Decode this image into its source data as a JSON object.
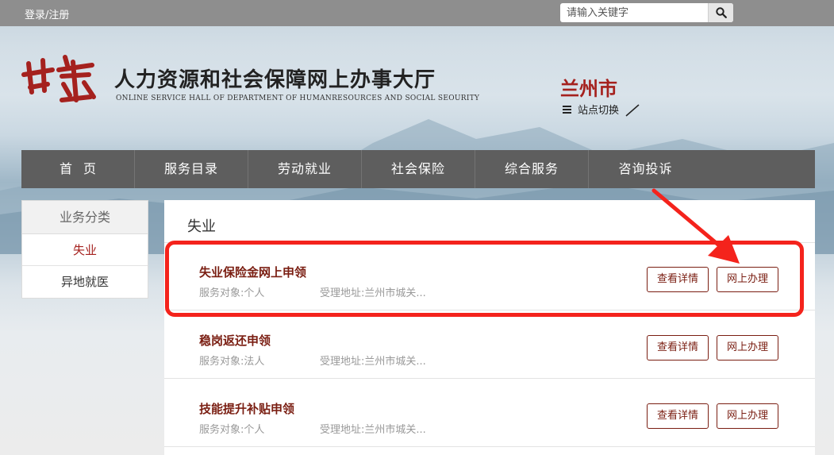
{
  "topbar": {
    "login_label": "登录/注册",
    "search_placeholder": "请输入关键字"
  },
  "header": {
    "logo_text": "甘肃",
    "title": "人力资源和社会保障网上办事大厅",
    "subtitle": "ONLINE SERVICE HALL OF DEPARTMENT OF HUMANRESOURCES AND SOCIAL SEOURITY",
    "city": "兰州市",
    "switch_label": "站点切换"
  },
  "nav": {
    "items": [
      "首页",
      "服务目录",
      "劳动就业",
      "社会保险",
      "综合服务",
      "咨询投诉"
    ]
  },
  "sidebar": {
    "heading": "业务分类",
    "items": [
      {
        "label": "失业",
        "active": true
      },
      {
        "label": "异地就医",
        "active": false
      }
    ]
  },
  "main": {
    "section_title": "失业",
    "rows": [
      {
        "name": "失业保险金网上申领",
        "object": "服务对象:个人",
        "address": "受理地址:兰州市城关...",
        "detail_label": "查看详情",
        "online_label": "网上办理"
      },
      {
        "name": "稳岗返还申领",
        "object": "服务对象:法人",
        "address": "受理地址:兰州市城关...",
        "detail_label": "查看详情",
        "online_label": "网上办理"
      },
      {
        "name": "技能提升补贴申领",
        "object": "服务对象:个人",
        "address": "受理地址:兰州市城关...",
        "detail_label": "查看详情",
        "online_label": "网上办理"
      }
    ]
  },
  "colors": {
    "accent": "#a5211e",
    "nav_bg": "#5e5e5e",
    "highlight": "#f4231c"
  }
}
